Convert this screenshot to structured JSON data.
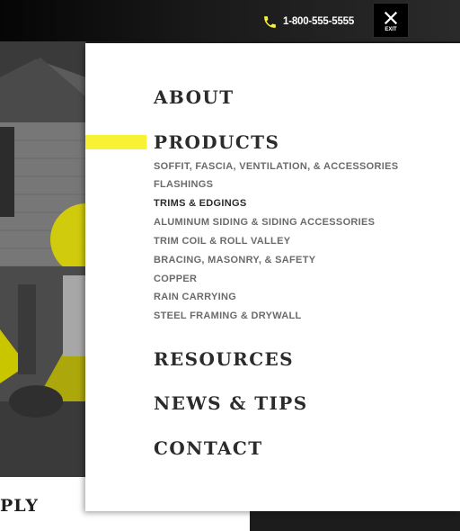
{
  "topbar": {
    "phone": "1-800-555-5555",
    "exit_label": "EXIT",
    "phone_icon": "phone-icon",
    "close_icon": "close-icon"
  },
  "menu": {
    "items": [
      {
        "label": "ABOUT"
      },
      {
        "label": "PRODUCTS"
      },
      {
        "label": "RESOURCES"
      },
      {
        "label": "NEWS & TIPS"
      },
      {
        "label": "CONTACT"
      }
    ],
    "products_submenu": [
      "SOFFIT, FASCIA, VENTILATION, & ACCESSORIES",
      "FLASHINGS",
      "TRIMS & EDGINGS",
      "ALUMINUM SIDING & SIDING ACCESSORIES",
      "TRIM COIL & ROLL VALLEY",
      "BRACING, MASONRY, & SAFETY",
      "COPPER",
      "RAIN CARRYING",
      "STEEL FRAMING & DRYWALL"
    ],
    "active_subitem": "TRIMS & EDGINGS"
  },
  "background": {
    "partial_heading": "PLY"
  },
  "colors": {
    "accent": "#f7f233",
    "menu_text": "#2b2b2b",
    "sub_text": "#6b6b6b",
    "topbar": "#1a1a1a"
  }
}
